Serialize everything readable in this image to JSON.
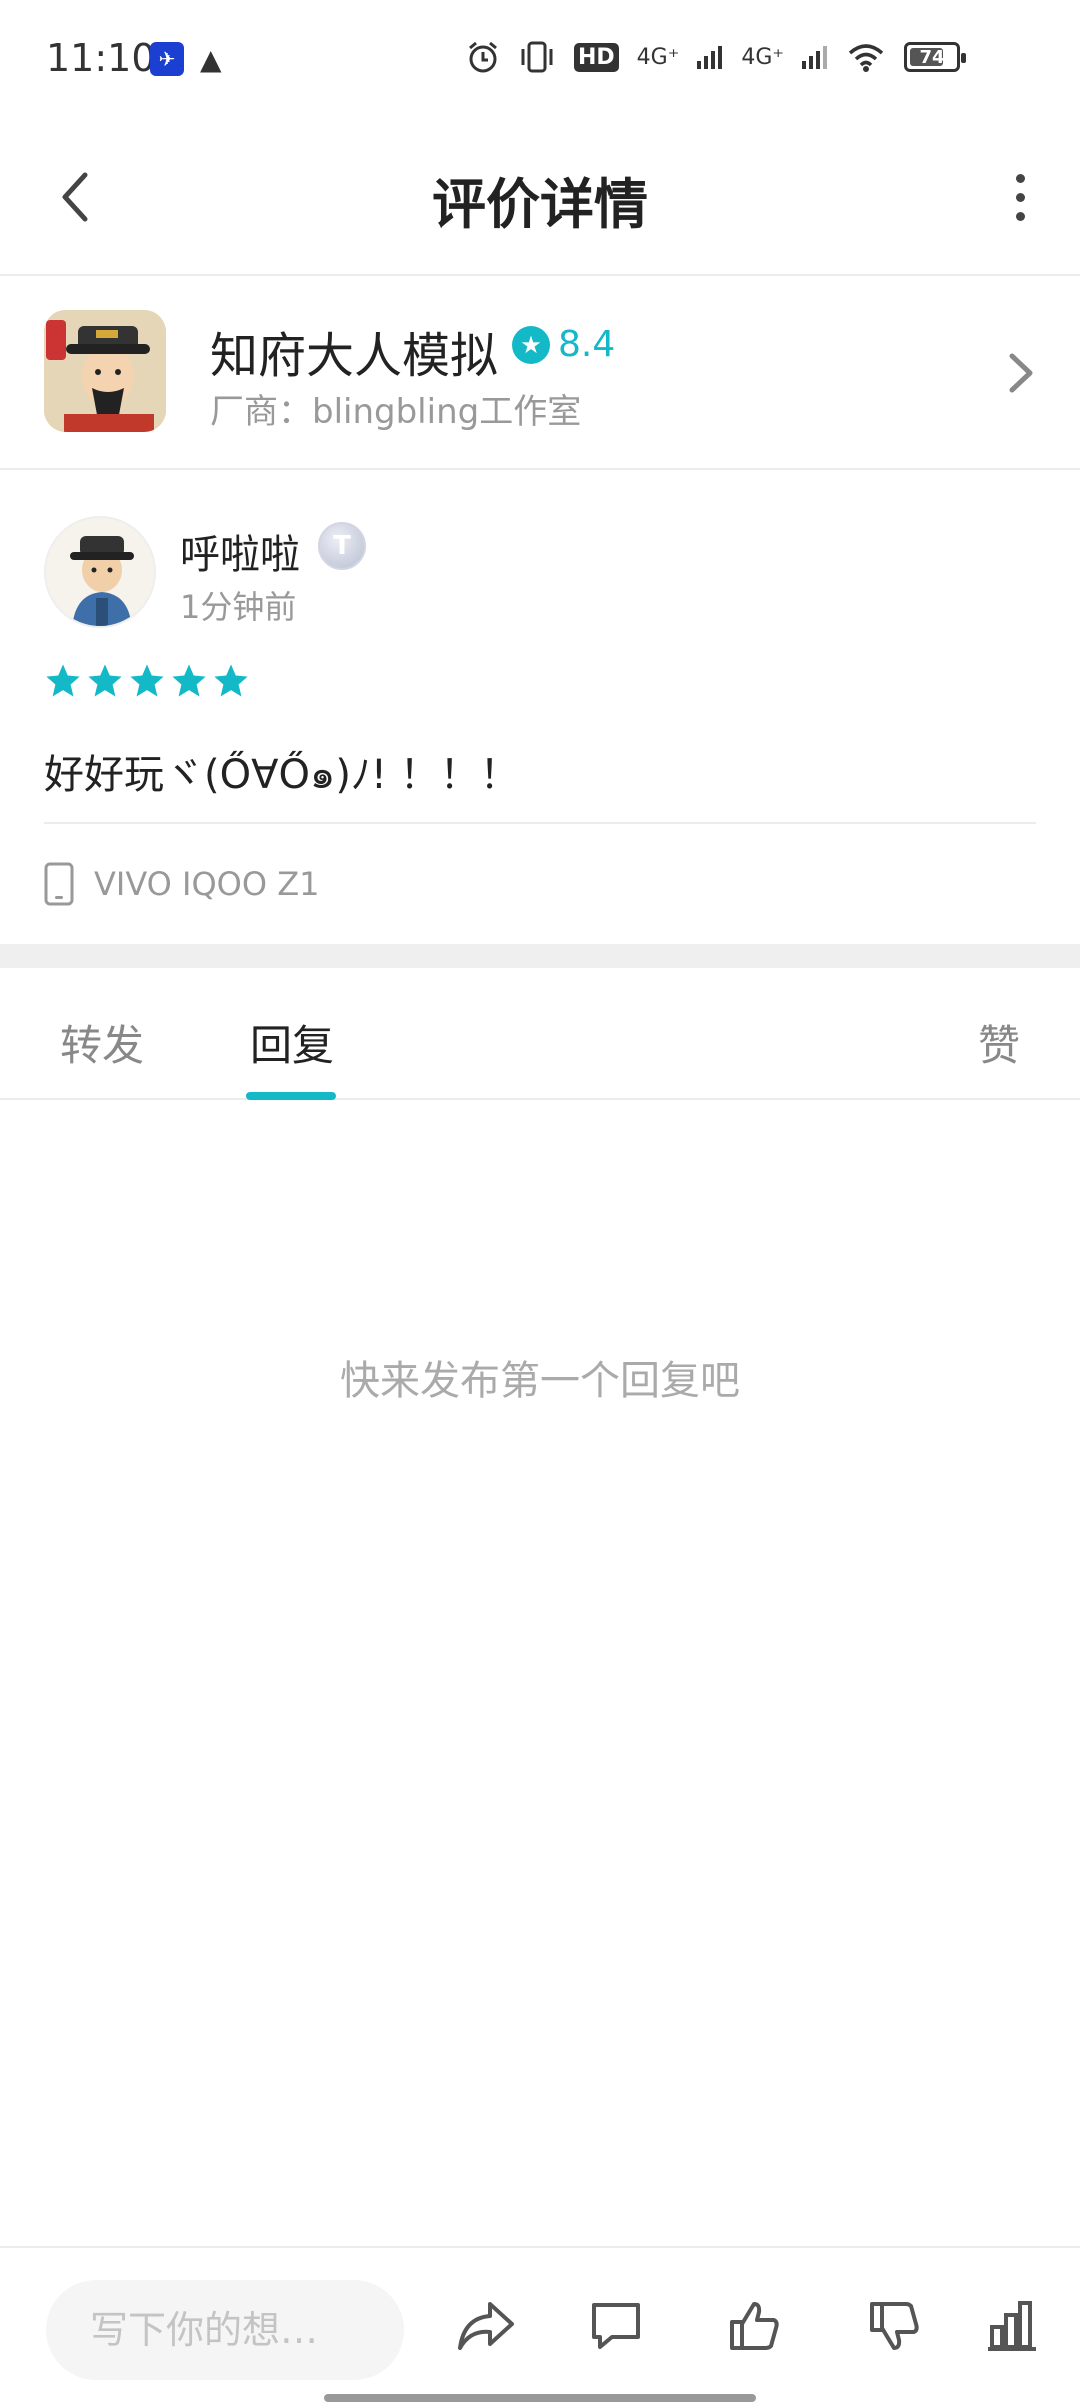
{
  "status_bar": {
    "time": "11:10",
    "hd_label": "HD",
    "net1": "4G⁺",
    "net2": "4G⁺",
    "battery": "74",
    "battery_level": 0.74
  },
  "header": {
    "title": "评价详情"
  },
  "game": {
    "name": "知府大人模拟",
    "score": "8.4",
    "vendor": "厂商：blingbling工作室",
    "accent_color": "#14b9c8"
  },
  "review": {
    "username": "呼啦啦",
    "badge": "T",
    "time": "1分钟前",
    "stars": 5,
    "text": "好好玩ヾ(Ő∀Ő๑)ﾉ! ！！！",
    "device": "VIVO IQOO Z1"
  },
  "tabs": [
    {
      "label": "转发"
    },
    {
      "label": "回复"
    },
    {
      "label": "赞"
    }
  ],
  "active_tab": "回复",
  "empty_hint": "快来发布第一个回复吧",
  "bottom_bar": {
    "input_placeholder": "写下你的想…"
  },
  "icons": {
    "back": "back-arrow-icon",
    "more": "more-vertical-icon",
    "share": "share-icon",
    "comment": "comment-icon",
    "like": "thumbs-up-icon",
    "dislike": "thumbs-down-icon",
    "stats": "bar-chart-icon",
    "device": "phone-icon"
  }
}
